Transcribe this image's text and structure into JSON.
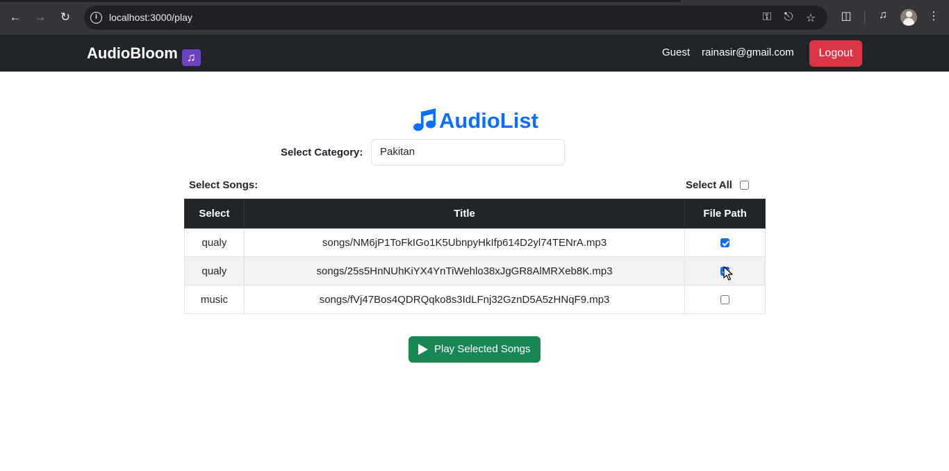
{
  "browser": {
    "url": "localhost:3000/play",
    "icons": [
      "back-arrow-icon",
      "forward-arrow-icon",
      "reload-icon",
      "site-info-icon",
      "password-key-icon",
      "install-app-icon",
      "bookmark-star-icon",
      "extensions-icon",
      "media-control-icon",
      "profile-avatar-icon",
      "more-menu-icon"
    ]
  },
  "navbar": {
    "brand": "AudioBloom",
    "brand_icon": "music-notes-icon",
    "guest": "Guest",
    "email": "rainasir@gmail.com",
    "logout_label": "Logout"
  },
  "main": {
    "title": "AudioList",
    "title_icon": "music-note-icon",
    "category_label": "Select Category:",
    "category_value": "Pakitan",
    "songs_label": "Select Songs:",
    "select_all_label": "Select All",
    "select_all_checked": false,
    "table": {
      "headers": [
        "Select",
        "Title",
        "File Path"
      ],
      "rows": [
        {
          "select": "qualy",
          "title": "songs/NM6jP1ToFkIGo1K5UbnpyHkIfp614D2yl74TENrA.mp3",
          "checked": true
        },
        {
          "select": "qualy",
          "title": "songs/25s5HnNUhKiYX4YnTiWehlo38xJgGR8AlMRXeb8K.mp3",
          "checked": true
        },
        {
          "select": "music",
          "title": "songs/fVj47Bos4QDRQqko8s3IdLFnj32GznD5A5zHNqF9.mp3",
          "checked": false
        }
      ]
    },
    "play_button_label": "Play Selected Songs"
  },
  "colors": {
    "navbar_bg": "#212529",
    "primary": "#0d6efd",
    "danger": "#dc3545",
    "success": "#198754",
    "brand_icon_bg": "#6f42c1"
  }
}
